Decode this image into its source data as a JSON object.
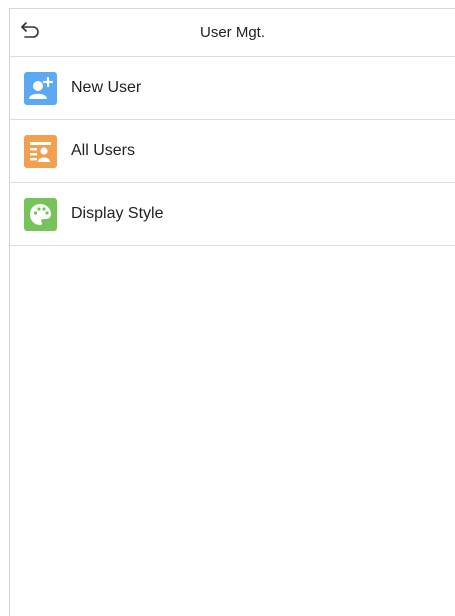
{
  "header": {
    "title": "User Mgt.",
    "back_icon": "back-arrow-icon"
  },
  "menu": {
    "items": [
      {
        "label": "New User",
        "icon": "add-user-icon",
        "color": "#5aa9f2"
      },
      {
        "label": "All Users",
        "icon": "user-list-icon",
        "color": "#f0a050"
      },
      {
        "label": "Display Style",
        "icon": "palette-icon",
        "color": "#76c35b"
      }
    ]
  },
  "colors": {
    "divider": "#dcdcdc",
    "text": "#222222",
    "background": "#ffffff"
  }
}
